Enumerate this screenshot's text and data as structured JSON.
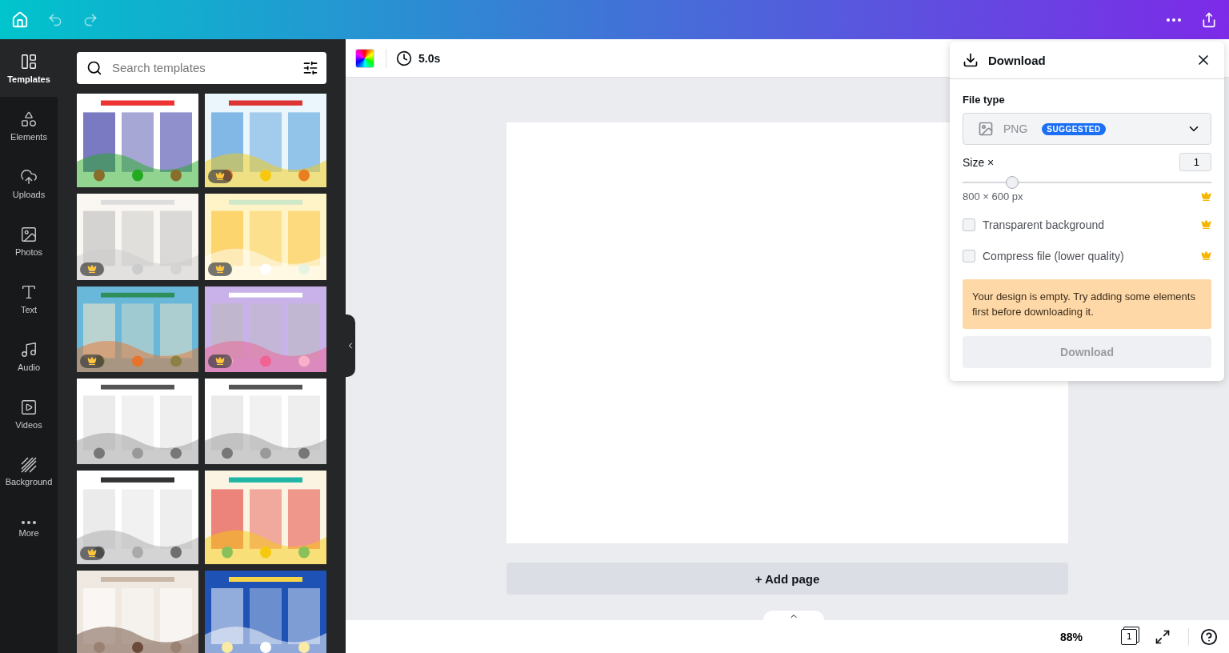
{
  "rail": [
    {
      "label": "Templates",
      "selected": true
    },
    {
      "label": "Elements",
      "selected": false
    },
    {
      "label": "Uploads",
      "selected": false
    },
    {
      "label": "Photos",
      "selected": false
    },
    {
      "label": "Text",
      "selected": false
    },
    {
      "label": "Audio",
      "selected": false
    },
    {
      "label": "Videos",
      "selected": false
    },
    {
      "label": "Background",
      "selected": false
    },
    {
      "label": "More",
      "selected": false
    }
  ],
  "search": {
    "placeholder": "Search templates"
  },
  "templates": [
    {
      "kind": "picture",
      "premium": false
    },
    {
      "kind": "picture",
      "premium": true
    },
    {
      "kind": "picture",
      "premium": true
    },
    {
      "kind": "picture",
      "premium": true
    },
    {
      "kind": "picture",
      "premium": true
    },
    {
      "kind": "picture",
      "premium": true
    },
    {
      "kind": "picture",
      "premium": false
    },
    {
      "kind": "picture",
      "premium": false
    },
    {
      "kind": "picture",
      "premium": true
    },
    {
      "kind": "picture",
      "premium": false
    },
    {
      "kind": "picture",
      "premium": false
    },
    {
      "kind": "picture",
      "premium": false
    }
  ],
  "toolbar": {
    "duration": "5.0s"
  },
  "add_page": "+ Add page",
  "bottom_bar": {
    "zoom": "88%",
    "page_count": "1"
  },
  "download_panel": {
    "title": "Download",
    "file_type_label": "File type",
    "file_type": "PNG",
    "badge": "SUGGESTED",
    "size_label": "Size ×",
    "size_value": "1",
    "size": {
      "level": 0.2
    },
    "dimensions": "800 × 600 px",
    "options": [
      {
        "label": "Transparent background",
        "checked": false
      },
      {
        "label": "Compress file (lower quality)",
        "checked": false
      }
    ],
    "warning": "Your design is empty. Try adding some elements first before downloading it.",
    "button": {
      "label": "Download",
      "disabled": true
    }
  }
}
